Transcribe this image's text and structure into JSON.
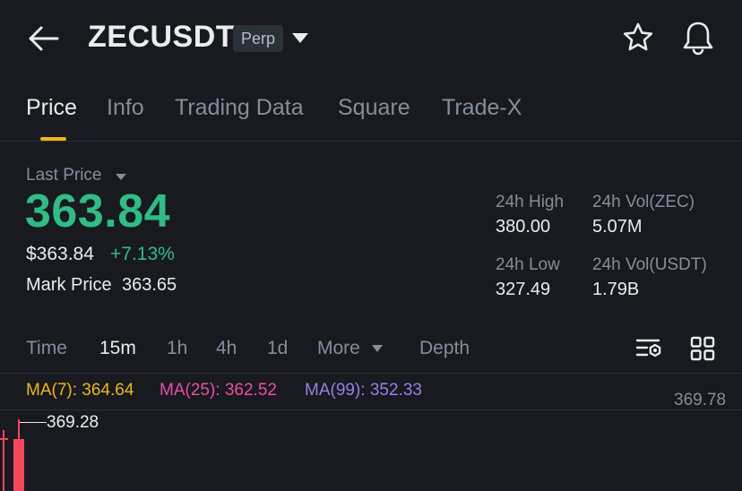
{
  "header": {
    "symbol": "ZECUSDT",
    "badge": "Perp",
    "icons": {
      "back": "arrow-left-icon",
      "favorite": "star-icon",
      "alert": "bell-icon",
      "dropdown": "caret-down-icon"
    }
  },
  "tabs": [
    {
      "label": "Price",
      "active": true
    },
    {
      "label": "Info"
    },
    {
      "label": "Trading Data"
    },
    {
      "label": "Square"
    },
    {
      "label": "Trade-X"
    }
  ],
  "ticker": {
    "last_price_label": "Last Price",
    "last_price": "363.84",
    "usd_price": "$363.84",
    "change_pct": "+7.13%",
    "mark_price_label": "Mark Price",
    "mark_price": "363.65",
    "stats": {
      "high_label": "24h High",
      "high": "380.00",
      "vol_base_label": "24h Vol(ZEC)",
      "vol_base": "5.07M",
      "low_label": "24h Low",
      "low": "327.49",
      "vol_quote_label": "24h Vol(USDT)",
      "vol_quote": "1.79B"
    },
    "colors": {
      "up": "#2ebd85",
      "down": "#f6465d",
      "accent": "#f0b90b"
    }
  },
  "chart_toolbar": {
    "intervals": [
      "Time",
      "15m",
      "1h",
      "4h",
      "1d",
      "More",
      "Depth"
    ],
    "active": "15m",
    "icons": {
      "settings": "chart-settings-icon",
      "layout": "grid-icon"
    }
  },
  "chart": {
    "ma7": "MA(7): 364.64",
    "ma25": "MA(25): 362.52",
    "ma99": "MA(99): 352.33",
    "axis_top": "369.78",
    "high_marker": "369.28"
  }
}
